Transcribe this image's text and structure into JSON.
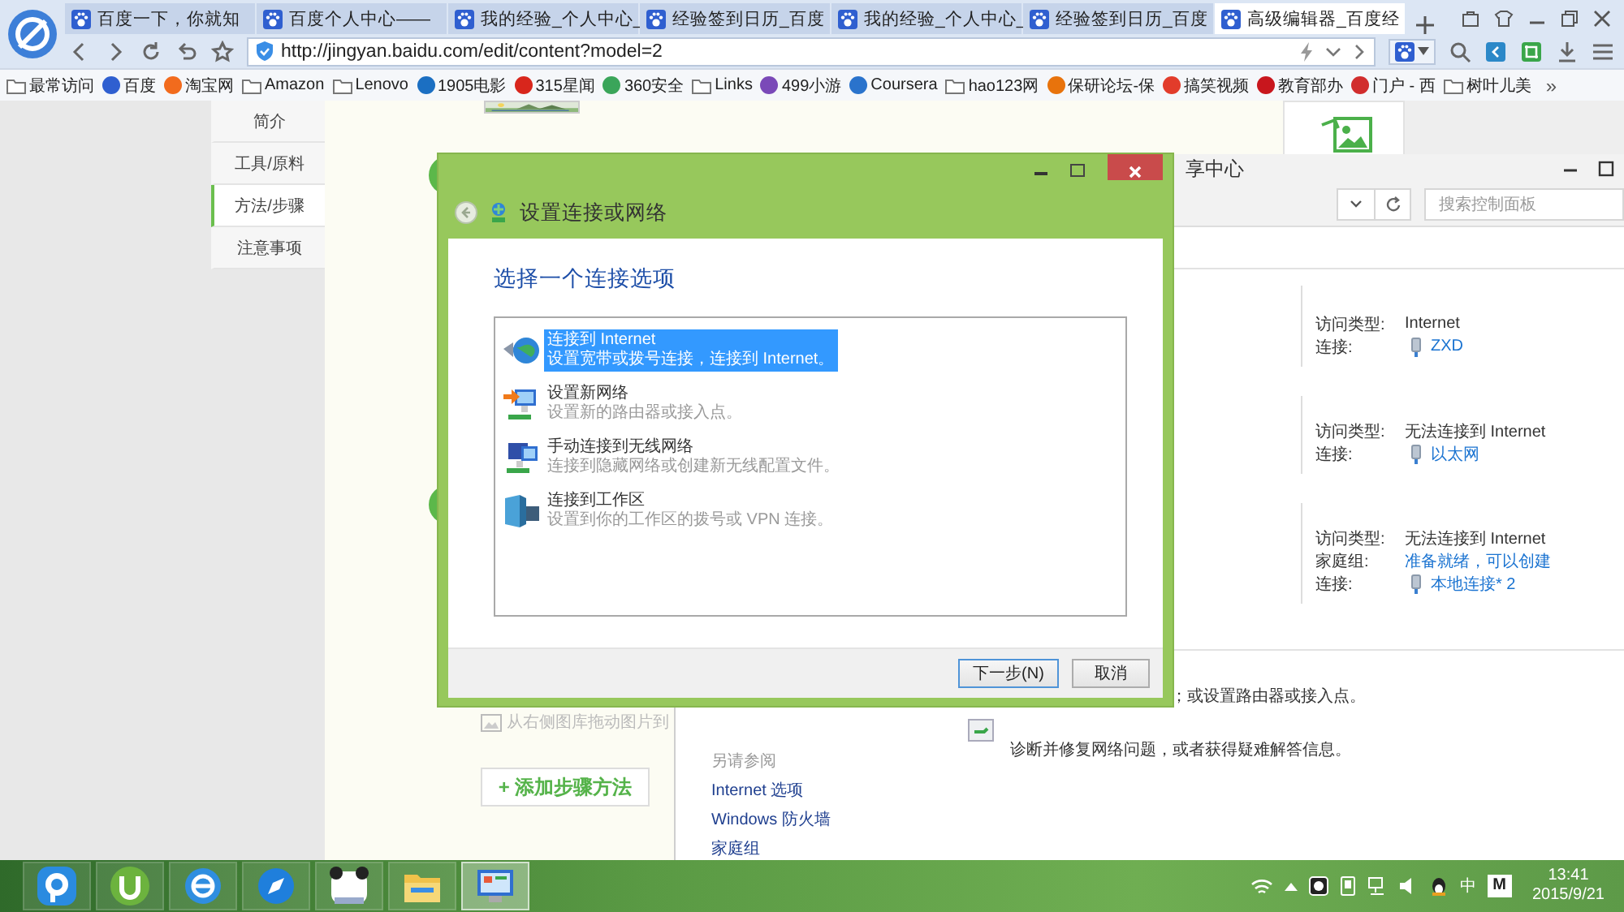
{
  "browser": {
    "tabs": [
      {
        "title": "百度一下，你就知",
        "selected": false
      },
      {
        "title": "百度个人中心——",
        "selected": false
      },
      {
        "title": "我的经验_个人中心_",
        "selected": false
      },
      {
        "title": "经验签到日历_百度",
        "selected": false
      },
      {
        "title": "我的经验_个人中心_",
        "selected": false
      },
      {
        "title": "经验签到日历_百度",
        "selected": false
      },
      {
        "title": "高级编辑器_百度经",
        "selected": true
      }
    ],
    "url": "http://jingyan.baidu.com/edit/content?model=2",
    "bookmarks": [
      {
        "label": "最常访问",
        "kind": "folder"
      },
      {
        "label": "百度",
        "kind": "site",
        "color": "#2f5fd0"
      },
      {
        "label": "淘宝网",
        "kind": "site",
        "color": "#f26b1d"
      },
      {
        "label": "Amazon",
        "kind": "folder"
      },
      {
        "label": "Lenovo",
        "kind": "folder"
      },
      {
        "label": "1905电影",
        "kind": "site",
        "color": "#1b6fc2"
      },
      {
        "label": "315星闻",
        "kind": "site",
        "color": "#d8261c"
      },
      {
        "label": "360安全",
        "kind": "site",
        "color": "#3aa55a"
      },
      {
        "label": "Links",
        "kind": "folder"
      },
      {
        "label": "499小游",
        "kind": "site",
        "color": "#7a49b8"
      },
      {
        "label": "Coursera",
        "kind": "site",
        "color": "#2a73cc"
      },
      {
        "label": "hao123网",
        "kind": "folder"
      },
      {
        "label": "保研论坛-保",
        "kind": "site",
        "color": "#e8730c"
      },
      {
        "label": "搞笑视频",
        "kind": "site",
        "color": "#e23c2b"
      },
      {
        "label": "教育部办",
        "kind": "site",
        "color": "#c8161d"
      },
      {
        "label": "门户 - 西",
        "kind": "site",
        "color": "#d12d2d"
      },
      {
        "label": "树叶儿美",
        "kind": "folder"
      }
    ],
    "more": "»"
  },
  "editor": {
    "sidebar": [
      {
        "label": "简介",
        "selected": false
      },
      {
        "label": "工具/原料",
        "selected": false
      },
      {
        "label": "方法/步骤",
        "selected": true
      },
      {
        "label": "注意事项",
        "selected": false
      }
    ],
    "image_hint": "从右侧图库拖动图片到",
    "add_step_button": "+ 添加步骤方法"
  },
  "control_panel": {
    "title": "享中心",
    "search_placeholder": "搜索控制面板",
    "networks": [
      {
        "rows": [
          {
            "label": "访问类型:",
            "value": "Internet",
            "kind": "text"
          },
          {
            "label": "连接:",
            "value": "ZXD",
            "kind": "connection"
          }
        ]
      },
      {
        "rows": [
          {
            "label": "访问类型:",
            "value": "无法连接到 Internet",
            "kind": "text"
          },
          {
            "label": "连接:",
            "value": "以太网",
            "kind": "connection"
          }
        ]
      },
      {
        "rows": [
          {
            "label": "访问类型:",
            "value": "无法连接到 Internet",
            "kind": "text"
          },
          {
            "label": "家庭组:",
            "value": "准备就绪，可以创建",
            "kind": "link"
          },
          {
            "label": "连接:",
            "value": "本地连接* 2",
            "kind": "connection"
          }
        ]
      }
    ],
    "router_text": "；或设置路由器或接入点。",
    "troubleshoot_text": "诊断并修复网络问题，或者获得疑难解答信息。",
    "see_also": {
      "heading": "另请参阅",
      "links": [
        "Internet 选项",
        "Windows 防火墙",
        "家庭组"
      ]
    }
  },
  "dialog": {
    "title": "设置连接或网络",
    "heading": "选择一个连接选项",
    "options": [
      {
        "title": "连接到 Internet",
        "description": "设置宽带或拨号连接，连接到 Internet。",
        "kind": "globe",
        "selected": true
      },
      {
        "title": "设置新网络",
        "description": "设置新的路由器或接入点。",
        "kind": "new-network",
        "selected": false
      },
      {
        "title": "手动连接到无线网络",
        "description": "连接到隐藏网络或创建新无线配置文件。",
        "kind": "wireless",
        "selected": false
      },
      {
        "title": "连接到工作区",
        "description": "设置到你的工作区的拨号或 VPN 连接。",
        "kind": "workplace",
        "selected": false
      }
    ],
    "buttons": [
      {
        "label": "下一步(N)",
        "default": true
      },
      {
        "label": "取消",
        "default": false
      }
    ]
  },
  "taskbar": {
    "apps": [
      {
        "kind": "player",
        "active": false
      },
      {
        "kind": "torrent",
        "active": false
      },
      {
        "kind": "ie",
        "active": false
      },
      {
        "kind": "compass",
        "active": false
      },
      {
        "kind": "panda",
        "active": false
      },
      {
        "kind": "folder",
        "active": false
      },
      {
        "kind": "control-panel",
        "active": true
      }
    ],
    "ime": "中",
    "ime_mode": "M",
    "time": "13:41",
    "date": "2015/9/21"
  }
}
